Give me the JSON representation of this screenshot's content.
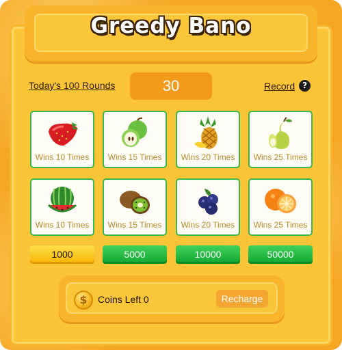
{
  "game": {
    "title": "Greedy Bano"
  },
  "header": {
    "rounds_label": "Today's 100 Rounds",
    "counter": "30",
    "record_label": "Record",
    "help_symbol": "?"
  },
  "cards": [
    {
      "fruit": "strawberry",
      "label": "Wins 10 Times"
    },
    {
      "fruit": "apple",
      "label": "Wins 15 Times"
    },
    {
      "fruit": "pineapple",
      "label": "Wins 20 Times"
    },
    {
      "fruit": "pear",
      "label": "Wins 25 Times"
    },
    {
      "fruit": "watermelon",
      "label": "Wins 10 Times"
    },
    {
      "fruit": "kiwi",
      "label": "Wins 15 Times"
    },
    {
      "fruit": "blueberry",
      "label": "Wins 20 Times"
    },
    {
      "fruit": "orange",
      "label": "Wins 25 Times"
    }
  ],
  "bets": [
    {
      "label": "1000",
      "color": "#f6b400",
      "selected": true
    },
    {
      "label": "5000",
      "color": "#11a531",
      "selected": false
    },
    {
      "label": "10000",
      "color": "#11a531",
      "selected": false
    },
    {
      "label": "50000",
      "color": "#11a531",
      "selected": false
    }
  ],
  "wallet": {
    "coin_symbol": "$",
    "coins_left": "Coins Left 0",
    "recharge_label": "Recharge"
  },
  "colors": {
    "board": "#f5a623",
    "card_border": "#38b84a",
    "counter_bg": "#f49a1a"
  }
}
